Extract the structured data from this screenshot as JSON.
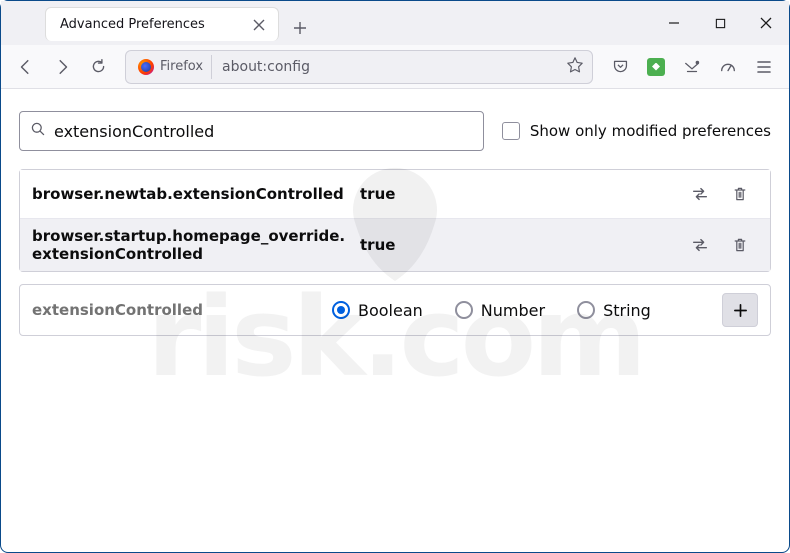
{
  "titlebar": {
    "tab_title": "Advanced Preferences"
  },
  "toolbar": {
    "identity_label": "Firefox",
    "url": "about:config"
  },
  "search": {
    "value": "extensionControlled",
    "modified_only_label": "Show only modified preferences"
  },
  "prefs": [
    {
      "name": "browser.newtab.extensionControlled",
      "value": "true"
    },
    {
      "name": "browser.startup.homepage_override.extensionControlled",
      "value": "true"
    }
  ],
  "create": {
    "name": "extensionControlled",
    "options": [
      "Boolean",
      "Number",
      "String"
    ],
    "selected": "Boolean"
  }
}
